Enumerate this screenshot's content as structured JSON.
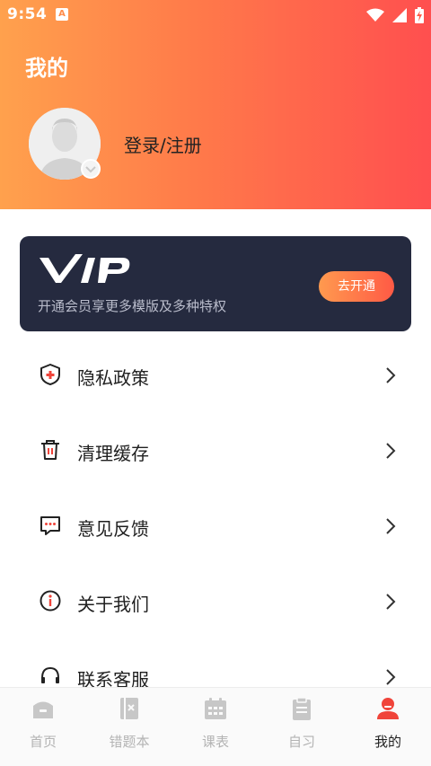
{
  "status_bar": {
    "time": "9:54",
    "notification_letter": "A"
  },
  "header": {
    "title": "我的",
    "login_text": "登录/注册"
  },
  "vip": {
    "logo_text": "VIP",
    "description": "开通会员享更多模版及多种特权",
    "button_label": "去开通"
  },
  "menu": {
    "items": [
      {
        "label": "隐私政策",
        "icon": "privacy-shield-icon"
      },
      {
        "label": "清理缓存",
        "icon": "trash-icon"
      },
      {
        "label": "意见反馈",
        "icon": "feedback-icon"
      },
      {
        "label": "关于我们",
        "icon": "info-icon"
      },
      {
        "label": "联系客服",
        "icon": "customer-service-icon"
      }
    ]
  },
  "tabbar": {
    "tabs": [
      {
        "label": "首页",
        "icon": "home-icon",
        "active": false
      },
      {
        "label": "错题本",
        "icon": "notebook-icon",
        "active": false
      },
      {
        "label": "课表",
        "icon": "calendar-icon",
        "active": false
      },
      {
        "label": "自习",
        "icon": "clipboard-icon",
        "active": false
      },
      {
        "label": "我的",
        "icon": "profile-icon",
        "active": true
      }
    ]
  },
  "colors": {
    "header_gradient_start": "#ffa14d",
    "header_gradient_end": "#ff4f4f",
    "vip_card_bg": "#252a3f",
    "accent_red": "#f0443a",
    "tab_inactive": "#c7c7c7"
  }
}
